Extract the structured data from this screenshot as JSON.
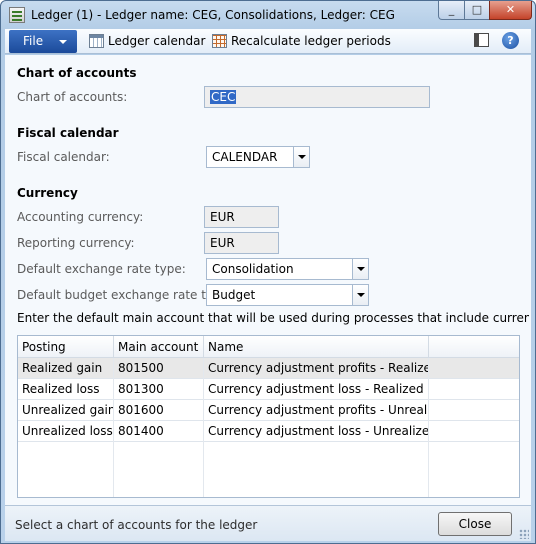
{
  "window": {
    "title": "Ledger (1) - Ledger name: CEG, Consolidations, Ledger: CEG",
    "minimize_glyph": "_",
    "maximize_glyph": "□",
    "close_glyph": "✕"
  },
  "toolbar": {
    "file_label": "File",
    "ledger_calendar_label": "Ledger calendar",
    "recalculate_label": "Recalculate ledger periods",
    "help_glyph": "?"
  },
  "chart_of_accounts": {
    "section_title": "Chart of accounts",
    "label": "Chart of accounts:",
    "value": "CEC"
  },
  "fiscal_calendar": {
    "section_title": "Fiscal calendar",
    "label": "Fiscal calendar:",
    "value": "CALENDAR"
  },
  "currency": {
    "section_title": "Currency",
    "accounting_label": "Accounting currency:",
    "accounting_value": "EUR",
    "reporting_label": "Reporting currency:",
    "reporting_value": "EUR",
    "exchange_rate_label": "Default exchange rate type:",
    "exchange_rate_value": "Consolidation",
    "budget_rate_label": "Default budget exchange rate type:",
    "budget_rate_value": "Budget"
  },
  "instruction": "Enter the default main account that will be used during processes that include currency revaluat",
  "grid": {
    "columns": [
      "Posting",
      "Main account",
      "Name"
    ],
    "rows": [
      {
        "posting": "Realized gain",
        "account": "801500",
        "name": "Currency adjustment profits - Realized"
      },
      {
        "posting": "Realized loss",
        "account": "801300",
        "name": "Currency adjustment loss - Realized"
      },
      {
        "posting": "Unrealized gain",
        "account": "801600",
        "name": "Currency adjustment profits - Unrealized"
      },
      {
        "posting": "Unrealized loss",
        "account": "801400",
        "name": "Currency adjustment loss - Unrealized"
      }
    ]
  },
  "status": {
    "text": "Select a chart of accounts for the ledger",
    "close_label": "Close"
  }
}
